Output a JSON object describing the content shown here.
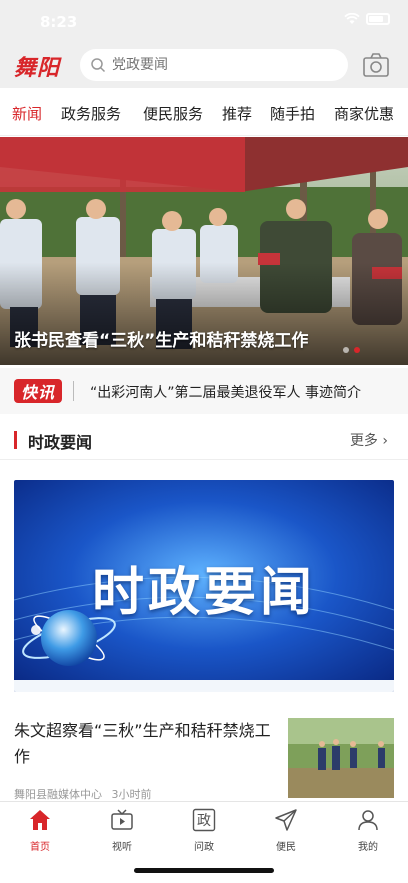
{
  "status": {
    "time": "8:23"
  },
  "header": {
    "logo_text": "舞阳",
    "search_placeholder": "党政要闻"
  },
  "nav": {
    "tabs": [
      {
        "label": "新闻",
        "active": true
      },
      {
        "label": "政务服务"
      },
      {
        "label": "便民服务"
      },
      {
        "label": "推荐"
      },
      {
        "label": "随手拍"
      },
      {
        "label": "商家优惠"
      }
    ]
  },
  "hero": {
    "caption": "张书民查看“三秋”生产和秸秆禁烧工作",
    "slide_count": 2,
    "active_slide": 1
  },
  "ticker": {
    "badge": "快讯",
    "text": "“出彩河南人”第二届最美退役军人 事迹简介"
  },
  "section": {
    "title": "时政要闻",
    "more": "更多"
  },
  "feature": {
    "title": "时政要闻"
  },
  "news": [
    {
      "title": "朱文超察看“三秋”生产和秸秆禁烧工作",
      "source": "舞阳县融媒体中心",
      "time": "3小时前"
    }
  ],
  "tabbar": {
    "items": [
      {
        "label": "首页",
        "icon": "home-icon",
        "active": true
      },
      {
        "label": "视听",
        "icon": "tv-icon"
      },
      {
        "label": "问政",
        "icon": "zheng-icon",
        "glyph": "政"
      },
      {
        "label": "便民",
        "icon": "send-icon"
      },
      {
        "label": "我的",
        "icon": "user-icon"
      }
    ]
  },
  "colors": {
    "accent": "#d8262a",
    "feature_blue": "#1a56c8"
  }
}
